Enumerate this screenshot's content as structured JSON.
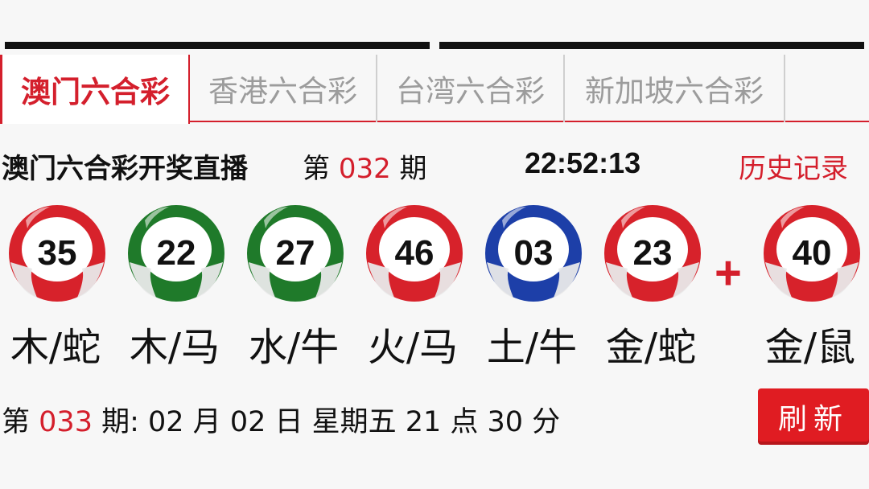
{
  "tabs": [
    {
      "label": "澳门六合彩",
      "active": true
    },
    {
      "label": "香港六合彩",
      "active": false
    },
    {
      "label": "台湾六合彩",
      "active": false
    },
    {
      "label": "新加坡六合彩",
      "active": false
    }
  ],
  "current": {
    "title": "澳门六合彩开奖直播",
    "issue_prefix": "第",
    "issue_number": "032",
    "issue_suffix": "期",
    "time": "22:52:13",
    "history_link": "历史记录"
  },
  "balls": [
    {
      "number": "35",
      "zodiac": "木/蛇",
      "color": "red",
      "hex": "#d7222b"
    },
    {
      "number": "22",
      "zodiac": "木/马",
      "color": "green",
      "hex": "#1f7a2a"
    },
    {
      "number": "27",
      "zodiac": "水/牛",
      "color": "green",
      "hex": "#1f7a2a"
    },
    {
      "number": "46",
      "zodiac": "火/马",
      "color": "red",
      "hex": "#d7222b"
    },
    {
      "number": "03",
      "zodiac": "土/牛",
      "color": "blue",
      "hex": "#1d3fa8"
    },
    {
      "number": "23",
      "zodiac": "金/蛇",
      "color": "red",
      "hex": "#d7222b"
    }
  ],
  "plus_sign": "+",
  "special_ball": {
    "number": "40",
    "zodiac": "金/鼠",
    "color": "red",
    "hex": "#d7222b"
  },
  "next_draw": {
    "prefix": "第",
    "issue_number": "033",
    "text": "期: 02 月 02 日 星期五 21 点 30 分"
  },
  "refresh_label": "刷新",
  "colors": {
    "accent": "#d41f2c",
    "button": "#e01c22"
  }
}
